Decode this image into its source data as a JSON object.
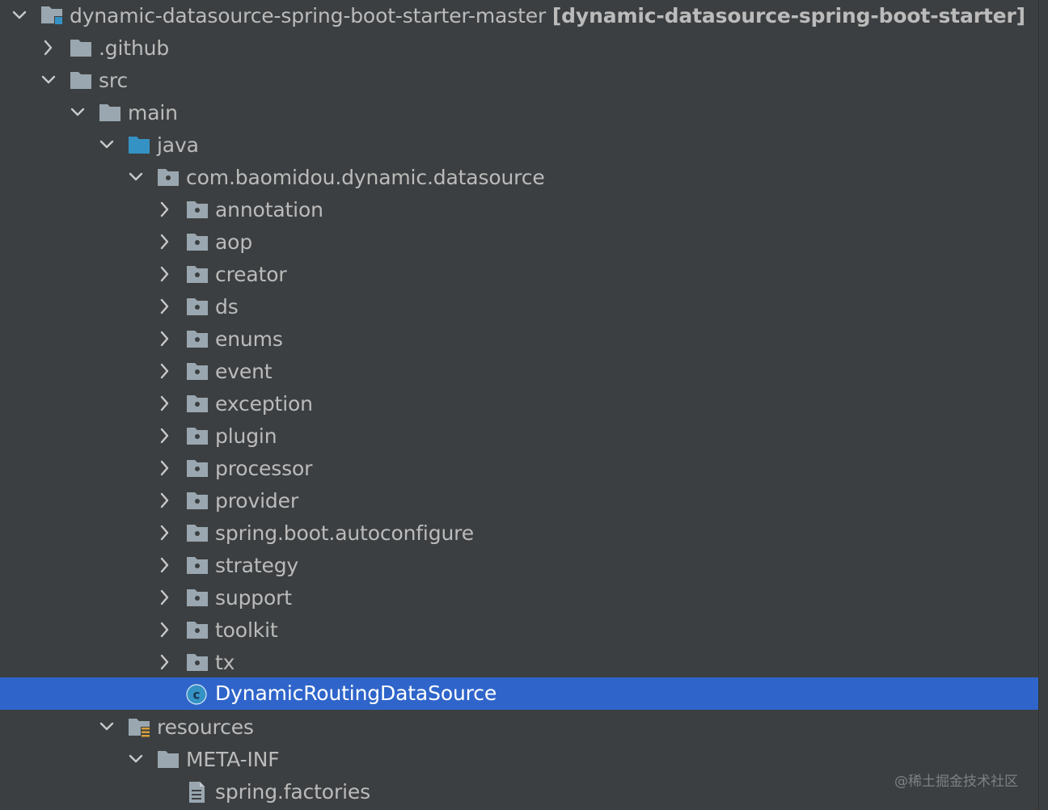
{
  "project_tree": {
    "root": {
      "name": "dynamic-datasource-spring-boot-starter-master",
      "module": "[dynamic-datasource-spring-boot-starter]"
    },
    "nodes": [
      {
        "label": ".github",
        "icon": "folder-icon",
        "expanded": false
      },
      {
        "label": "src",
        "icon": "folder-icon",
        "expanded": true
      },
      {
        "label": "main",
        "icon": "folder-icon",
        "expanded": true
      },
      {
        "label": "java",
        "icon": "source-root-folder-icon",
        "expanded": true
      },
      {
        "label": "com.baomidou.dynamic.datasource",
        "icon": "package-icon",
        "expanded": true
      },
      {
        "label": "annotation",
        "icon": "package-icon",
        "expanded": false
      },
      {
        "label": "aop",
        "icon": "package-icon",
        "expanded": false
      },
      {
        "label": "creator",
        "icon": "package-icon",
        "expanded": false
      },
      {
        "label": "ds",
        "icon": "package-icon",
        "expanded": false
      },
      {
        "label": "enums",
        "icon": "package-icon",
        "expanded": false
      },
      {
        "label": "event",
        "icon": "package-icon",
        "expanded": false
      },
      {
        "label": "exception",
        "icon": "package-icon",
        "expanded": false
      },
      {
        "label": "plugin",
        "icon": "package-icon",
        "expanded": false
      },
      {
        "label": "processor",
        "icon": "package-icon",
        "expanded": false
      },
      {
        "label": "provider",
        "icon": "package-icon",
        "expanded": false
      },
      {
        "label": "spring.boot.autoconfigure",
        "icon": "package-icon",
        "expanded": false
      },
      {
        "label": "strategy",
        "icon": "package-icon",
        "expanded": false
      },
      {
        "label": "support",
        "icon": "package-icon",
        "expanded": false
      },
      {
        "label": "toolkit",
        "icon": "package-icon",
        "expanded": false
      },
      {
        "label": "tx",
        "icon": "package-icon",
        "expanded": false
      },
      {
        "label": "DynamicRoutingDataSource",
        "icon": "java-class-icon",
        "selected": true
      },
      {
        "label": "resources",
        "icon": "resources-folder-icon",
        "expanded": true
      },
      {
        "label": "META-INF",
        "icon": "folder-icon",
        "expanded": true
      },
      {
        "label": "spring.factories",
        "icon": "text-file-icon"
      }
    ]
  },
  "watermark": "@稀土掘金技术社区",
  "colors": {
    "background": "#3c3f41",
    "text": "#bbbbbb",
    "selection": "#2f65ca",
    "folder": "#9aa7b0",
    "source_root": "#3592c4",
    "class_icon": "#3592c4"
  }
}
